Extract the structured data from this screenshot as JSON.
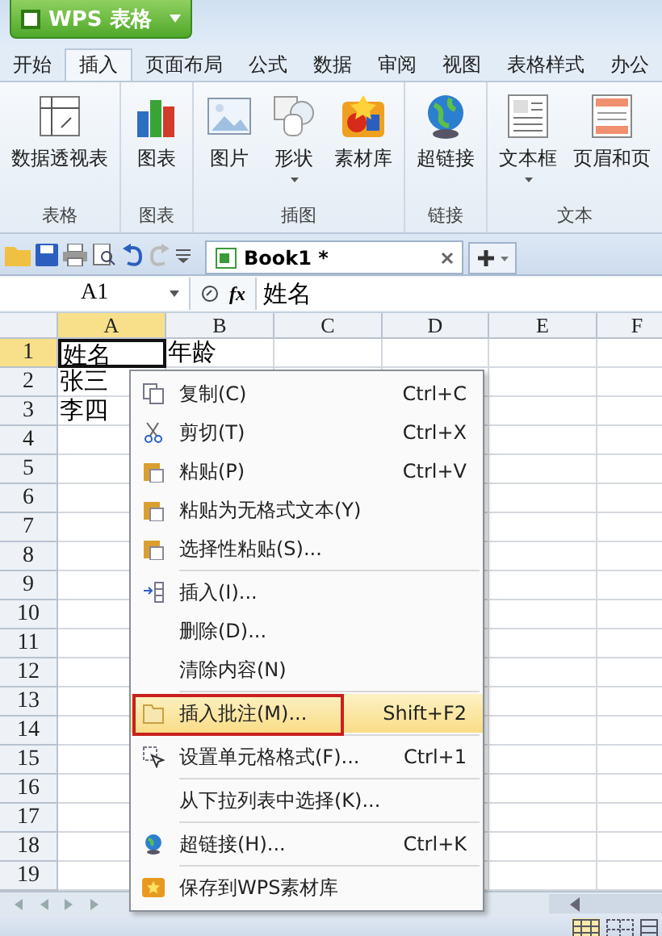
{
  "app_button": {
    "label": "WPS 表格"
  },
  "tabs": [
    {
      "label": "开始",
      "selected": false
    },
    {
      "label": "插入",
      "selected": true
    },
    {
      "label": "页面布局",
      "selected": false
    },
    {
      "label": "公式",
      "selected": false
    },
    {
      "label": "数据",
      "selected": false
    },
    {
      "label": "审阅",
      "selected": false
    },
    {
      "label": "视图",
      "selected": false
    },
    {
      "label": "表格样式",
      "selected": false
    },
    {
      "label": "办公",
      "selected": false
    }
  ],
  "ribbon_groups": [
    {
      "label": "表格",
      "buttons": [
        {
          "label": "数据透视表",
          "dropdown": false
        }
      ]
    },
    {
      "label": "图表",
      "buttons": [
        {
          "label": "图表",
          "dropdown": false
        }
      ]
    },
    {
      "label": "插图",
      "buttons": [
        {
          "label": "图片",
          "dropdown": false
        },
        {
          "label": "形状",
          "dropdown": true
        },
        {
          "label": "素材库",
          "dropdown": false
        }
      ]
    },
    {
      "label": "链接",
      "buttons": [
        {
          "label": "超链接",
          "dropdown": false
        }
      ]
    },
    {
      "label": "文本",
      "buttons": [
        {
          "label": "文本框",
          "dropdown": true
        },
        {
          "label": "页眉和页",
          "dropdown": false
        }
      ]
    }
  ],
  "document_tab": {
    "title": "Book1 *"
  },
  "formula_bar": {
    "name_box": "A1",
    "function_label": "fx",
    "value": "姓名"
  },
  "columns": [
    {
      "label": "A",
      "selected": true
    },
    {
      "label": "B",
      "selected": false
    },
    {
      "label": "C",
      "selected": false
    },
    {
      "label": "D",
      "selected": false
    },
    {
      "label": "E",
      "selected": false
    },
    {
      "label": "F",
      "selected": false
    }
  ],
  "rows": [
    {
      "label": "1",
      "selected": true,
      "cells": [
        "姓名",
        "年龄"
      ]
    },
    {
      "label": "2",
      "selected": false,
      "cells": [
        "张三"
      ]
    },
    {
      "label": "3",
      "selected": false,
      "cells": [
        "李四"
      ]
    },
    {
      "label": "4",
      "selected": false
    },
    {
      "label": "5",
      "selected": false
    },
    {
      "label": "6",
      "selected": false
    },
    {
      "label": "7",
      "selected": false
    },
    {
      "label": "8",
      "selected": false
    },
    {
      "label": "9",
      "selected": false
    },
    {
      "label": "10",
      "selected": false
    },
    {
      "label": "11",
      "selected": false
    },
    {
      "label": "12",
      "selected": false
    },
    {
      "label": "13",
      "selected": false
    },
    {
      "label": "14",
      "selected": false
    },
    {
      "label": "15",
      "selected": false
    },
    {
      "label": "16",
      "selected": false
    },
    {
      "label": "17",
      "selected": false
    },
    {
      "label": "18",
      "selected": false
    },
    {
      "label": "19",
      "selected": false
    }
  ],
  "context_menu": [
    {
      "label": "复制(C)",
      "shortcut": "Ctrl+C",
      "selected": false,
      "outlined": false,
      "separator_after": false
    },
    {
      "label": "剪切(T)",
      "shortcut": "Ctrl+X",
      "selected": false,
      "outlined": false,
      "separator_after": false
    },
    {
      "label": "粘贴(P)",
      "shortcut": "Ctrl+V",
      "selected": false,
      "outlined": false,
      "separator_after": false
    },
    {
      "label": "粘贴为无格式文本(Y)",
      "selected": false,
      "outlined": false,
      "separator_after": false
    },
    {
      "label": "选择性粘贴(S)...",
      "selected": false,
      "outlined": false,
      "separator_after": true
    },
    {
      "label": "插入(I)...",
      "selected": false,
      "outlined": false,
      "separator_after": false
    },
    {
      "label": "删除(D)...",
      "selected": false,
      "outlined": false,
      "separator_after": false
    },
    {
      "label": "清除内容(N)",
      "selected": false,
      "outlined": false,
      "separator_after": true
    },
    {
      "label": "插入批注(M)...",
      "shortcut": "Shift+F2",
      "selected": true,
      "outlined": true,
      "separator_after": true
    },
    {
      "label": "设置单元格格式(F)...",
      "shortcut": "Ctrl+1",
      "selected": false,
      "outlined": false,
      "separator_after": true
    },
    {
      "label": "从下拉列表中选择(K)...",
      "selected": false,
      "outlined": false,
      "separator_after": true
    },
    {
      "label": "超链接(H)...",
      "shortcut": "Ctrl+K",
      "selected": false,
      "outlined": false,
      "separator_after": true
    },
    {
      "label": "保存到WPS素材库",
      "selected": false,
      "outlined": false,
      "separator_after": false
    }
  ]
}
